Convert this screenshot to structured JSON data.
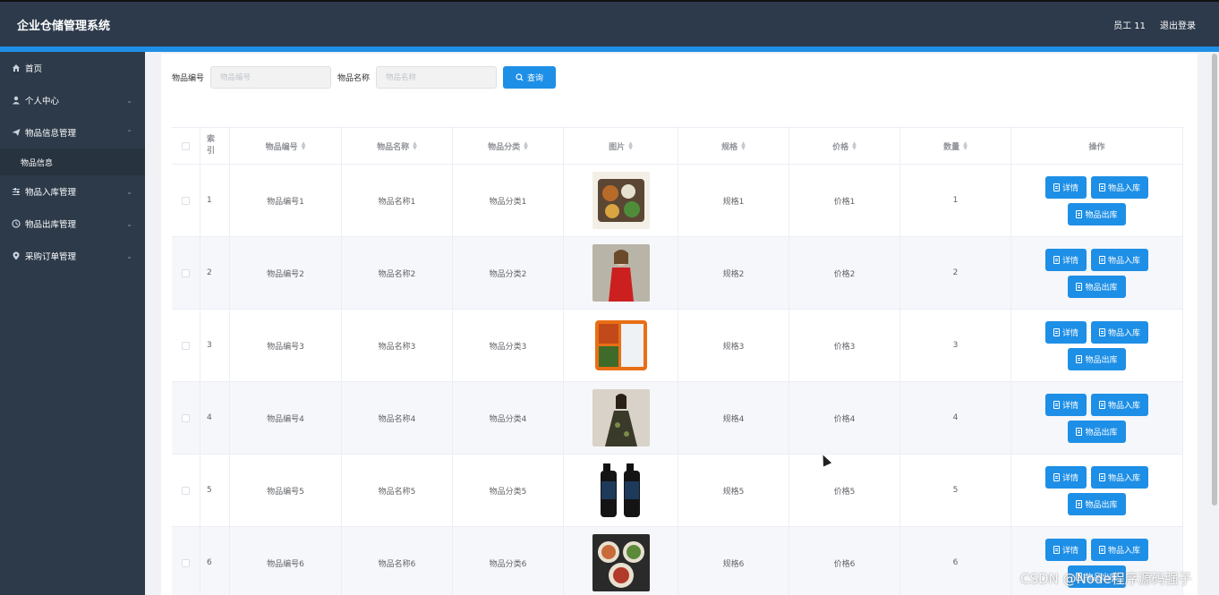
{
  "app": {
    "title": "企业仓储管理系统"
  },
  "header": {
    "user": "员工 11",
    "logout": "退出登录"
  },
  "sidebar": {
    "items": [
      {
        "label": "首页",
        "icon": "home-icon",
        "chevron": ""
      },
      {
        "label": "个人中心",
        "icon": "user-icon",
        "chevron": "⌄"
      },
      {
        "label": "物品信息管理",
        "icon": "send-icon",
        "chevron": "⌃"
      },
      {
        "label": "物品入库管理",
        "icon": "sliders-icon",
        "chevron": "⌄"
      },
      {
        "label": "物品出库管理",
        "icon": "clock-icon",
        "chevron": "⌄"
      },
      {
        "label": "采购订单管理",
        "icon": "location-icon",
        "chevron": "⌄"
      }
    ],
    "submenu": {
      "label": "物品信息"
    }
  },
  "search": {
    "code_label": "物品编号",
    "code_placeholder": "物品编号",
    "name_label": "物品名称",
    "name_placeholder": "物品名称",
    "button": "查询"
  },
  "table": {
    "headers": {
      "index_line1": "索",
      "index_line2": "引",
      "code": "物品编号",
      "name": "物品名称",
      "category": "物品分类",
      "image": "图片",
      "spec": "规格",
      "price": "价格",
      "qty": "数量",
      "ops": "操作"
    },
    "rows": [
      {
        "index": "1",
        "code": "物品编号1",
        "name": "物品名称1",
        "category": "物品分类1",
        "spec": "规格1",
        "price": "价格1",
        "qty": "1",
        "image": "food-bento-image"
      },
      {
        "index": "2",
        "code": "物品编号2",
        "name": "物品名称2",
        "category": "物品分类2",
        "spec": "规格2",
        "price": "价格2",
        "qty": "2",
        "image": "woman-red-dress-image"
      },
      {
        "index": "3",
        "code": "物品编号3",
        "name": "物品名称3",
        "category": "物品分类3",
        "spec": "规格3",
        "price": "价格3",
        "qty": "3",
        "image": "lunchbox-image"
      },
      {
        "index": "4",
        "code": "物品编号4",
        "name": "物品名称4",
        "category": "物品分类4",
        "spec": "规格4",
        "price": "价格4",
        "qty": "4",
        "image": "woman-dress-image"
      },
      {
        "index": "5",
        "code": "物品编号5",
        "name": "物品名称5",
        "category": "物品分类5",
        "spec": "规格5",
        "price": "价格5",
        "qty": "5",
        "image": "bottles-image"
      },
      {
        "index": "6",
        "code": "物品编号6",
        "name": "物品名称6",
        "category": "物品分类6",
        "spec": "规格6",
        "price": "价格6",
        "qty": "6",
        "image": "dishes-image"
      }
    ],
    "actions": {
      "detail": "详情",
      "stock_in": "物品入库",
      "stock_out": "物品出库"
    }
  },
  "watermark": "CSDN @Node程序源码强子",
  "colors": {
    "header": "#2c3a4b",
    "sidebar": "#2d3a4a",
    "accent": "#1e8fe6"
  }
}
